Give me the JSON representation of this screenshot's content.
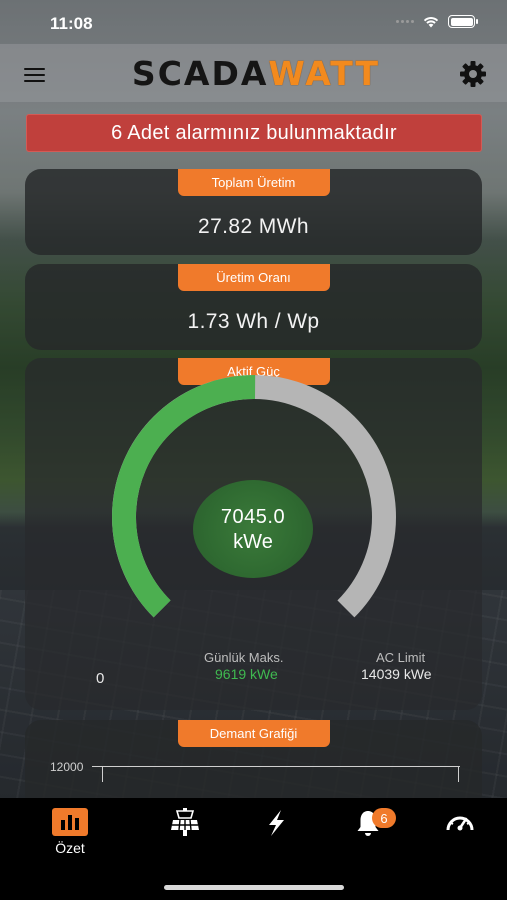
{
  "status_bar": {
    "time": "11:08"
  },
  "header": {
    "logo_part1": "SCADA",
    "logo_part2": "WATT",
    "menu_icon": "hamburger-menu-icon",
    "settings_icon": "gear-icon"
  },
  "alarm": {
    "text": "6 Adet alarmınız bulunmaktadır"
  },
  "cards": {
    "total_production": {
      "label": "Toplam Üretim",
      "value": "27.82 MWh"
    },
    "production_ratio": {
      "label": "Üretim Oranı",
      "value": "1.73 Wh / Wp"
    },
    "active_power": {
      "label": "Aktif Güç",
      "value": "7045.0",
      "unit": "kWe",
      "zero": "0",
      "daily_max_label": "Günlük Maks.",
      "daily_max_value": "9619 kWe",
      "ac_limit_label": "AC Limit",
      "ac_limit_value": "14039 kWe",
      "fill_fraction": 0.5018
    },
    "demand_chart": {
      "label": "Demant Grafiği",
      "y_tick": "12000"
    }
  },
  "tab_bar": {
    "tabs": [
      {
        "label": "Özet",
        "icon": "bar-chart-icon",
        "active": true
      },
      {
        "label": "",
        "icon": "solar-panel-icon"
      },
      {
        "label": "",
        "icon": "lightning-icon"
      },
      {
        "label": "",
        "icon": "bell-icon",
        "badge": "6"
      },
      {
        "label": "",
        "icon": "speedometer-icon"
      }
    ]
  },
  "colors": {
    "accent": "#f07a2b",
    "alarm": "#c0403c",
    "gauge_fill": "#4caf50",
    "gauge_track": "#b5b5b5",
    "daily_max": "#3fb950"
  }
}
